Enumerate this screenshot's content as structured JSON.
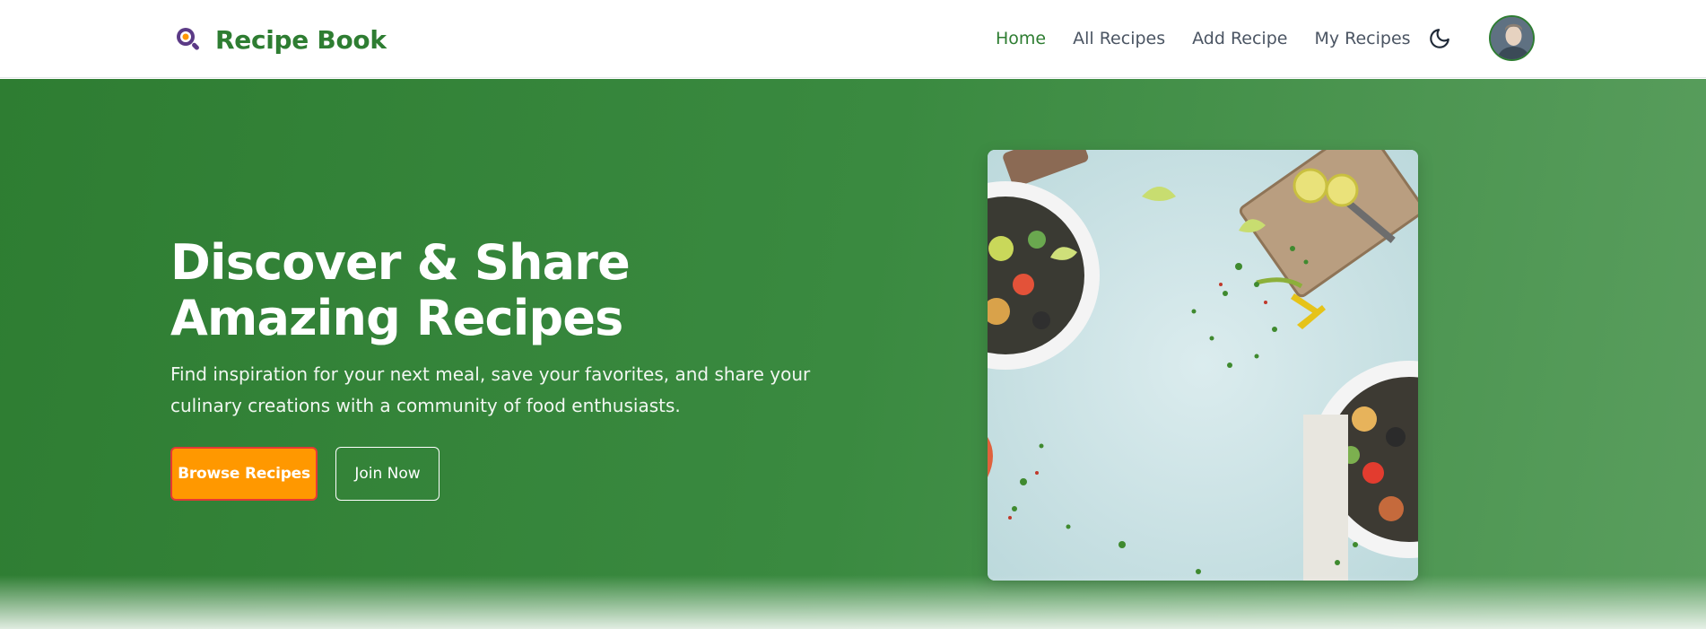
{
  "brand": {
    "name": "Recipe Book",
    "icon": "magnifier-chef-icon",
    "color": "#2e7d32"
  },
  "nav": {
    "links": [
      {
        "label": "Home",
        "active": true
      },
      {
        "label": "All Recipes",
        "active": false
      },
      {
        "label": "Add Recipe",
        "active": false
      },
      {
        "label": "My Recipes",
        "active": false
      }
    ],
    "theme_toggle_icon": "moon-icon",
    "avatar_icon": "user-avatar"
  },
  "hero": {
    "title_line1": "Discover & Share",
    "title_line2": "Amazing Recipes",
    "subtitle_line1": "Find inspiration for your next meal, save your favorites, and share your",
    "subtitle_line2": "culinary creations with a community of food enthusiasts.",
    "primary_button": "Browse Recipes",
    "secondary_button": "Join Now",
    "image_icon": "salad-plates-photo",
    "background_color": "#2e7d32",
    "primary_button_color": "#ff9800"
  }
}
